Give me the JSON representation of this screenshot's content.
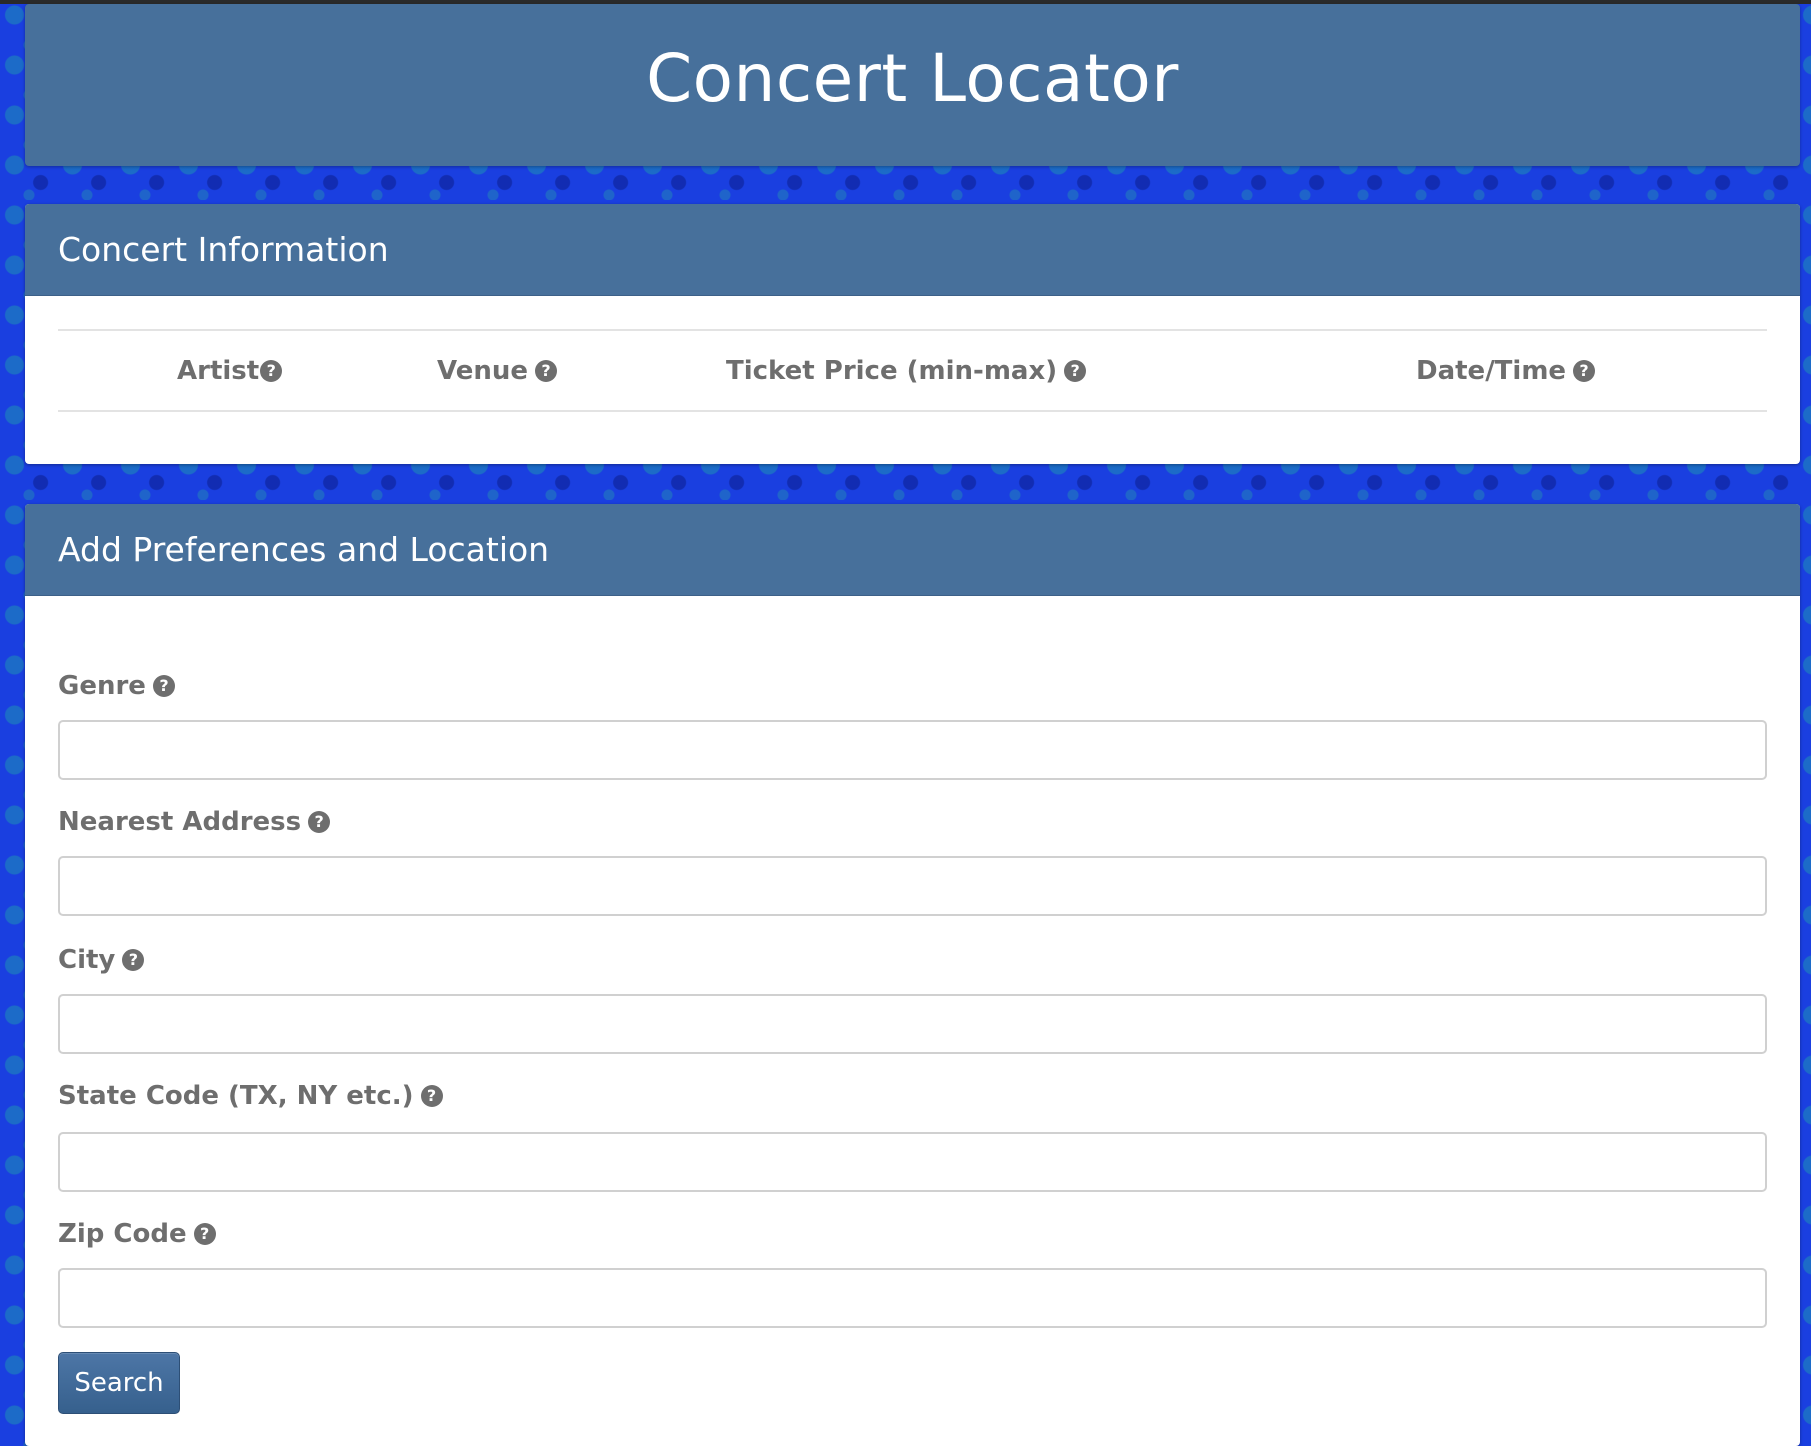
{
  "page": {
    "title": "Concert Locator"
  },
  "concert_info": {
    "heading": "Concert Information",
    "columns": [
      {
        "label": "Artist",
        "icon": "question-circle-icon"
      },
      {
        "label": "Venue",
        "icon": "question-circle-icon"
      },
      {
        "label": "Ticket Price (min-max)",
        "icon": "question-circle-icon"
      },
      {
        "label": "Date/Time",
        "icon": "question-circle-icon"
      }
    ],
    "rows": []
  },
  "preferences": {
    "heading": "Add Preferences and Location",
    "fields": [
      {
        "label": "Genre",
        "value": "",
        "icon": "question-circle-icon"
      },
      {
        "label": "Nearest Address",
        "value": "",
        "icon": "question-circle-icon"
      },
      {
        "label": "City",
        "value": "",
        "icon": "question-circle-icon"
      },
      {
        "label": "State Code (TX, NY etc.)",
        "value": "",
        "icon": "question-circle-icon"
      },
      {
        "label": "Zip Code",
        "value": "",
        "icon": "question-circle-icon"
      }
    ],
    "search_label": "Search"
  },
  "help_glyph": "?",
  "colors": {
    "header_bg": "#47709b",
    "page_bg": "#1a3fe0",
    "label_text": "#6e6e6e",
    "button_bg": "#3f6895"
  }
}
